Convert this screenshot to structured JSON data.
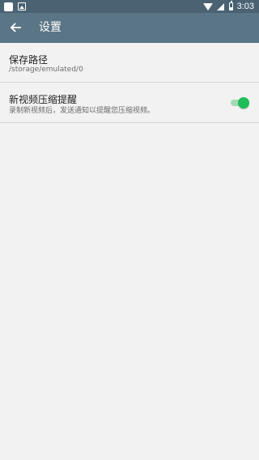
{
  "status_bar": {
    "time": "3:03",
    "left_icons": [
      "app-notification-icon",
      "image-icon"
    ],
    "right_icons": [
      "wifi-icon",
      "signal-icon",
      "battery-icon"
    ]
  },
  "app_bar": {
    "title": "设置",
    "back_icon": "arrow-left-icon",
    "background": "#5a7585"
  },
  "settings": {
    "save_path": {
      "title": "保存路径",
      "value": "/storage/emulated/0"
    },
    "new_video_notify": {
      "title": "新视频压缩提醒",
      "description": "录制新视频后，发送通知以提醒您压缩视频。",
      "enabled": true,
      "accent": "#1fbe57"
    }
  },
  "colors": {
    "status_bar": "#4a6272",
    "background": "#f2f2f2",
    "divider": "#d6d6d6"
  }
}
